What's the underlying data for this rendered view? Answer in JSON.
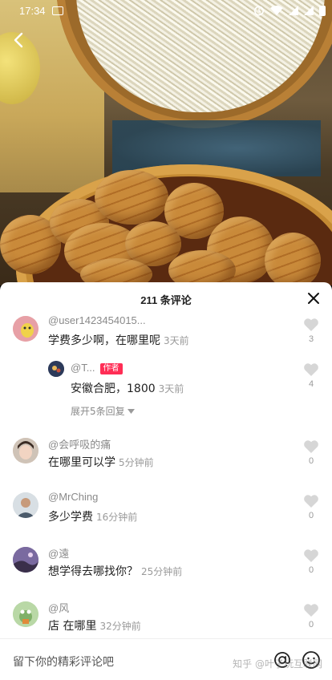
{
  "status_bar": {
    "time": "17:34"
  },
  "sheet": {
    "title": "211 条评论"
  },
  "comments": [
    {
      "user": "@user1423454015...",
      "text": "学费多少啊，在哪里呢",
      "time": "3天前",
      "likes": "3"
    },
    {
      "user": "@T...",
      "badge": "作者",
      "text": "安徽合肥，1800",
      "time": "3天前",
      "likes": "4"
    },
    {
      "user": "@会呼吸的痛",
      "text": "在哪里可以学",
      "time": "5分钟前",
      "likes": "0"
    },
    {
      "user": "@MrChing",
      "text": "多少学费",
      "time": "16分钟前",
      "likes": "0"
    },
    {
      "user": "@遠",
      "text": "想学得去哪找你？",
      "time": "25分钟前",
      "likes": "0"
    },
    {
      "user": "@风",
      "text": "店 在哪里",
      "time": "32分钟前",
      "likes": "0"
    }
  ],
  "expand_replies": "展开5条回复",
  "input": {
    "placeholder": "留下你的精彩评论吧"
  },
  "watermark": "知乎 @叶子玩互联网"
}
